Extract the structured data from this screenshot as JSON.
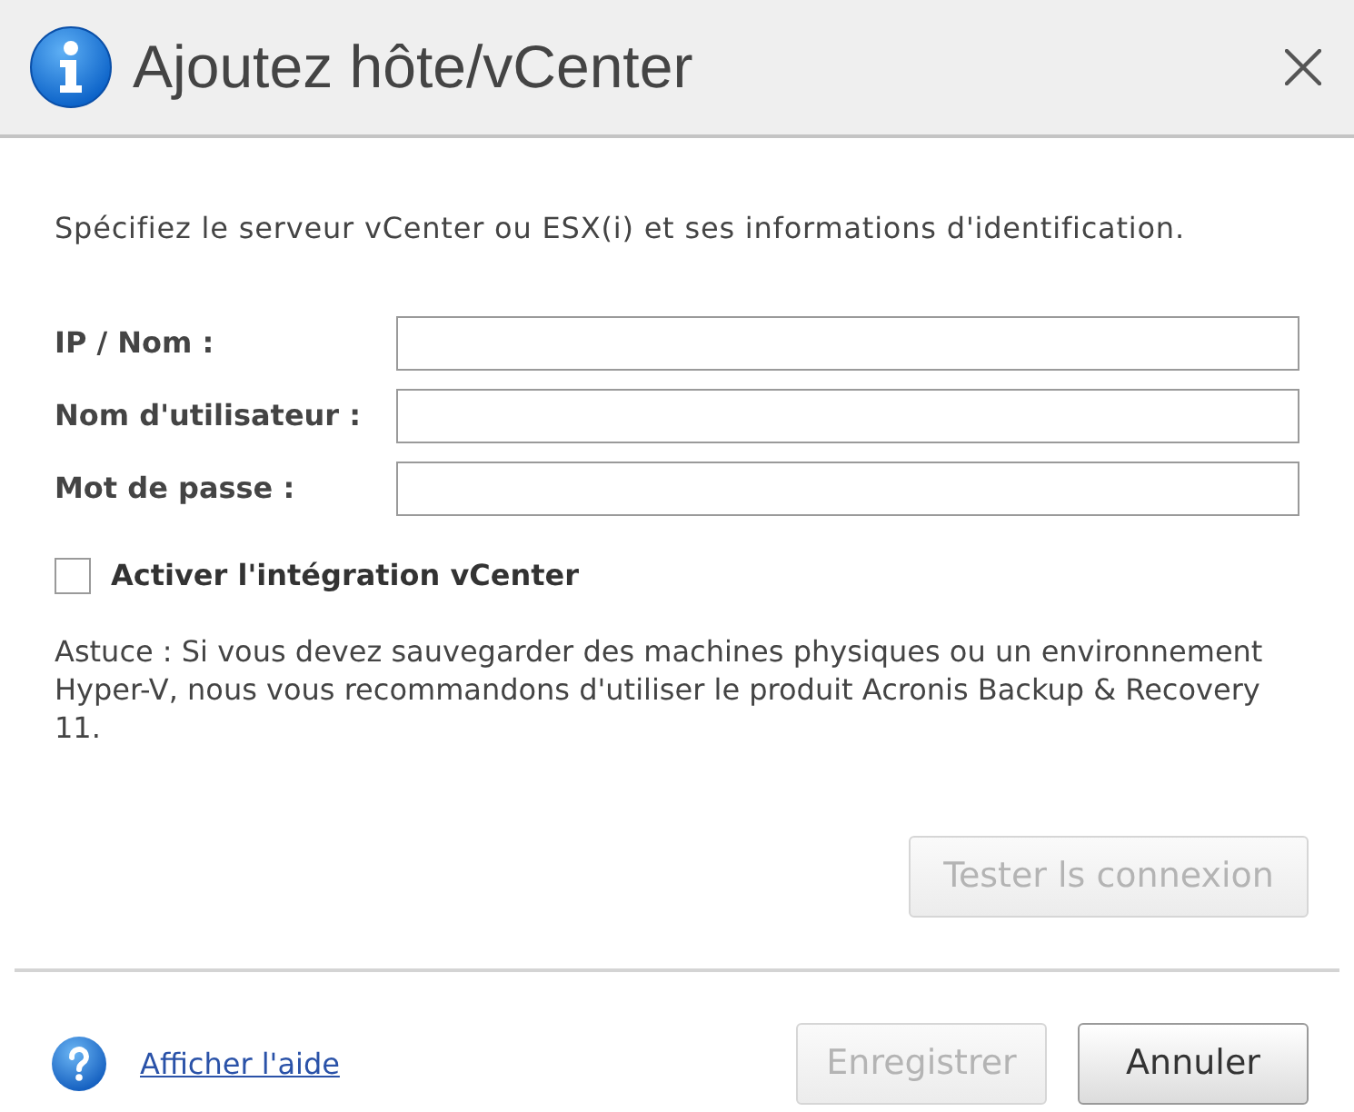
{
  "window": {
    "title": "Ajoutez hôte/vCenter"
  },
  "intro": "Spécifiez le serveur vCenter ou ESX(i) et ses informations d'identification.",
  "fields": [
    {
      "label": "IP / Nom :"
    },
    {
      "label": "Nom d'utilisateur :"
    },
    {
      "label": "Mot de passe :"
    }
  ],
  "checkbox": {
    "label": "Activer l'intégration vCenter",
    "checked": false
  },
  "tip": "Astuce : Si vous devez sauvegarder des machines physiques ou un environnement Hyper-V, nous vous recommandons d'utiliser le produit Acronis Backup & Recovery 11.",
  "test_button": {
    "label": "Tester ls connexion",
    "disabled": true
  },
  "footer": {
    "help_link": "Afficher l'aide",
    "buttons": [
      {
        "label": "Enregistrer",
        "disabled": true
      },
      {
        "label": "Annuler",
        "disabled": false
      }
    ]
  }
}
